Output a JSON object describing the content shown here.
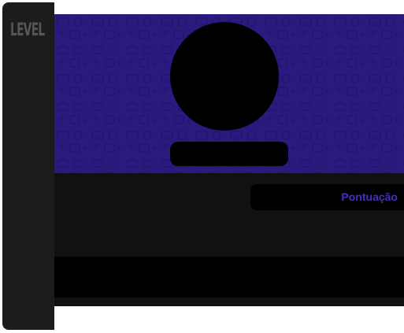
{
  "sidebar": {
    "level_label": "LEVEL"
  },
  "profile": {
    "score_label": "Pontuação"
  },
  "colors": {
    "banner": "#2a1a80",
    "pattern": "#21166a",
    "accent_text": "#4133b8",
    "sidebar": "#1c1c1c",
    "panel": "#111111"
  },
  "icons": {
    "banner_pattern": "gamepad-doodle-icons"
  }
}
